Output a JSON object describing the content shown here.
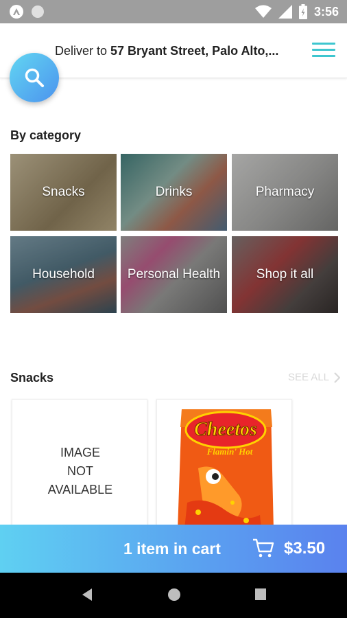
{
  "status_bar": {
    "time": "3:56",
    "icons": [
      "app-a-icon",
      "dot-icon",
      "wifi-icon",
      "signal-icon",
      "battery-icon"
    ]
  },
  "header": {
    "deliver_prefix": "Deliver to ",
    "address": "57 Bryant Street, Palo Alto,..."
  },
  "category": {
    "title": "By category",
    "tiles": [
      {
        "label": "Snacks",
        "color": "#b8a580"
      },
      {
        "label": "Drinks",
        "color": "#6f9a8f"
      },
      {
        "label": "Pharmacy",
        "color": "#a9aaa8"
      },
      {
        "label": "Household",
        "color": "#6f8a98"
      },
      {
        "label": "Personal Health",
        "color": "#8b8a88"
      },
      {
        "label": "Shop it all",
        "color": "#6e6866"
      }
    ]
  },
  "snacks": {
    "title": "Snacks",
    "see_all": "SEE ALL",
    "cards": [
      {
        "image_text": [
          "IMAGE",
          "NOT",
          "AVAILABLE"
        ]
      },
      {
        "product_brand": "Cheetos",
        "product_sub": "Flamin' Hot"
      }
    ]
  },
  "cart": {
    "count_text": "1 item in cart",
    "price": "$3.50"
  },
  "colors": {
    "accent": "#3ec6cf",
    "fab_start": "#62d6f2",
    "fab_end": "#4c93ee"
  }
}
